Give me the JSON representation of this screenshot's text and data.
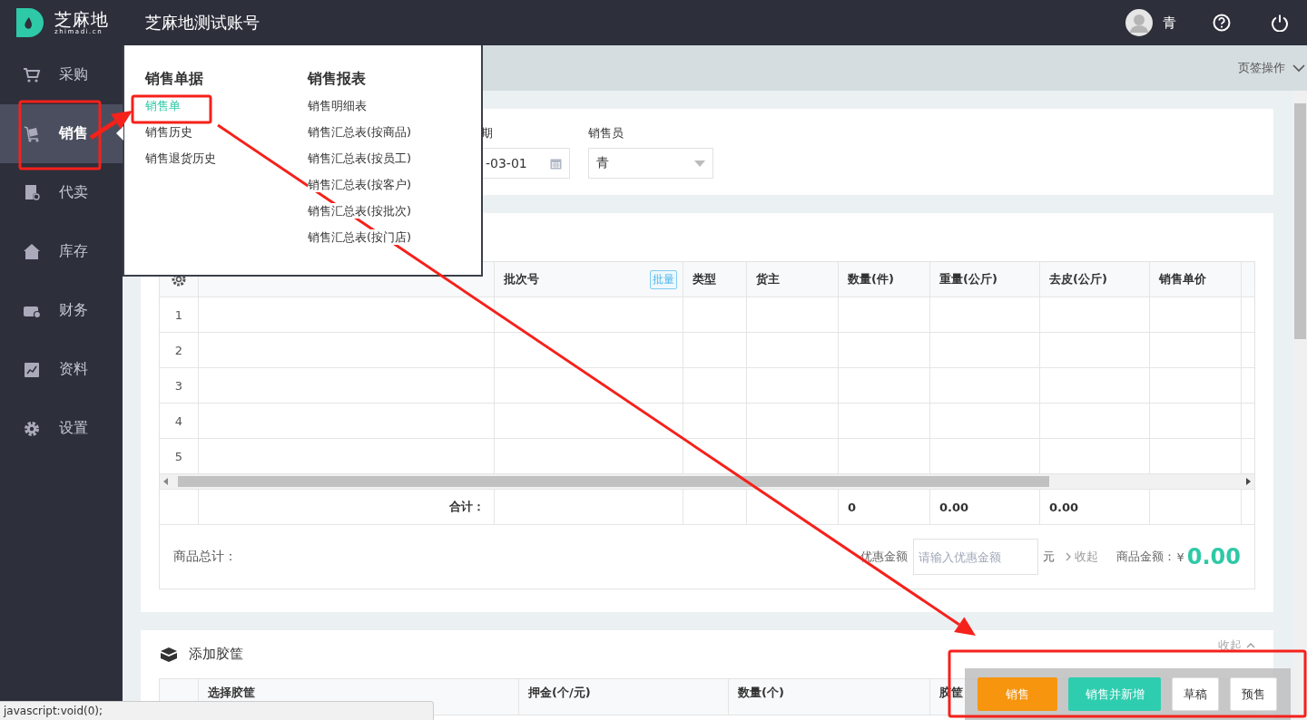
{
  "header": {
    "logo_text": "芝麻地",
    "logo_domain": "zhimadi.cn",
    "account": "芝麻地测试账号",
    "user": "青"
  },
  "sidebar": {
    "items": [
      {
        "label": "采购",
        "selected": false
      },
      {
        "label": "销售",
        "selected": true
      },
      {
        "label": "代卖",
        "selected": false
      },
      {
        "label": "库存",
        "selected": false
      },
      {
        "label": "财务",
        "selected": false
      },
      {
        "label": "资料",
        "selected": false
      },
      {
        "label": "设置",
        "selected": false
      }
    ]
  },
  "flyout": {
    "columns": [
      {
        "title": "销售单据",
        "items": [
          {
            "label": "销售单",
            "selected": true
          },
          {
            "label": "销售历史",
            "selected": false
          },
          {
            "label": "销售退货历史",
            "selected": false
          }
        ]
      },
      {
        "title": "销售报表",
        "items": [
          {
            "label": "销售明细表",
            "selected": false
          },
          {
            "label": "销售汇总表(按商品)",
            "selected": false
          },
          {
            "label": "销售汇总表(按员工)",
            "selected": false
          },
          {
            "label": "销售汇总表(按客户)",
            "selected": false
          },
          {
            "label": "销售汇总表(按批次)",
            "selected": false
          },
          {
            "label": "销售汇总表(按门店)",
            "selected": false
          }
        ]
      }
    ]
  },
  "tab_bar": {
    "menu": "页签操作"
  },
  "filters": [
    {
      "label": "期",
      "value": "-03-01",
      "kind": "date"
    },
    {
      "label": "销售员",
      "value": "青",
      "kind": "select"
    }
  ],
  "goods_table": {
    "columns": [
      "批次号",
      "类型",
      "货主",
      "数量(件)",
      "重量(公斤)",
      "去皮(公斤)",
      "销售单价"
    ],
    "batch_button": "批量",
    "rows": [
      "1",
      "2",
      "3",
      "4",
      "5"
    ],
    "totals_label": "合计：",
    "totals": {
      "quantity": "0",
      "weight": "0.00",
      "tare": "0.00"
    }
  },
  "summary": {
    "label": "商品总计：",
    "discount_label": "优惠金额",
    "discount_placeholder": "请输入优惠金额",
    "unit": "元",
    "collapse": "收起",
    "amount_label": "商品金额：",
    "currency": "¥",
    "amount": "0.00"
  },
  "crate_section": {
    "title": "添加胶筐",
    "collapse": "收起",
    "columns": [
      "选择胶筐",
      "押金(个/元)",
      "数量(个)",
      "胶筐"
    ]
  },
  "actions": [
    {
      "label": "销售",
      "kind": "primary"
    },
    {
      "label": "销售并新增",
      "kind": "success"
    },
    {
      "label": "草稿",
      "kind": "default"
    },
    {
      "label": "预售",
      "kind": "default"
    }
  ],
  "status_bar": "javascript:void(0);",
  "annotations": [
    {
      "kind": "box"
    },
    {
      "kind": "box"
    },
    {
      "kind": "box"
    },
    {
      "kind": "arrow"
    },
    {
      "kind": "arrow"
    }
  ]
}
